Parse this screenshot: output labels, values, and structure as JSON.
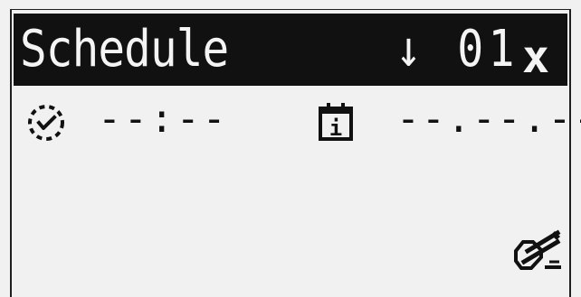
{
  "header": {
    "title": "Schedule",
    "entry_indicator": "↓ 01",
    "close_label": "x"
  },
  "time": {
    "icon": "clock-icon",
    "value": "--:--"
  },
  "date": {
    "icon": "calendar-icon",
    "icon_label": "i",
    "value": "--.--.--"
  },
  "edit": {
    "icon": "edit-pencil-icon"
  },
  "colors": {
    "background": "#f1f1f1",
    "header_background": "#111111",
    "header_text": "#f4f4f4",
    "text": "#111111"
  }
}
